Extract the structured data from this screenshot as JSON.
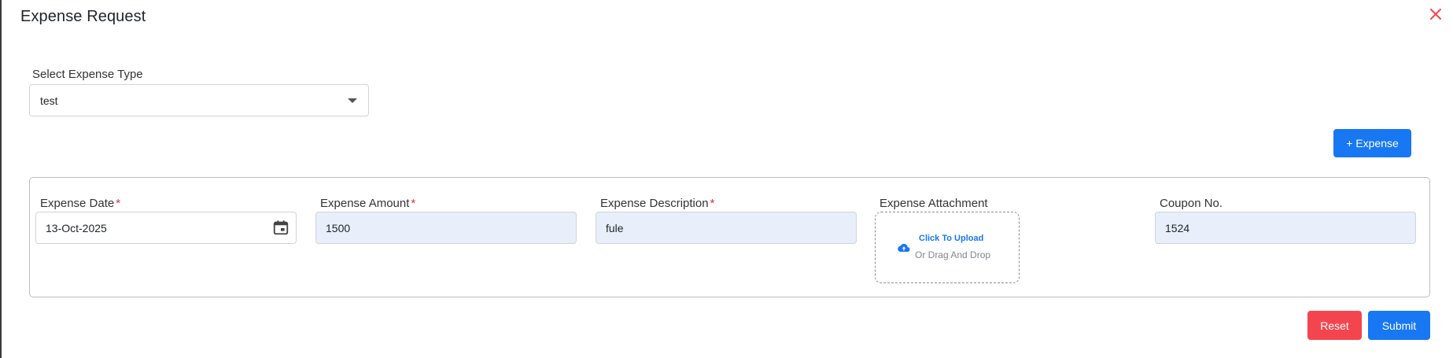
{
  "modal": {
    "title": "Expense Request",
    "close_icon": "close-icon",
    "close_color": "#f4454f"
  },
  "expense_type": {
    "label": "Select Expense Type",
    "value": "test"
  },
  "add_expense_label": "+ Expense",
  "expense_row": {
    "date": {
      "label": "Expense Date",
      "required": "*",
      "value": "13-Oct-2025",
      "icon": "calendar-icon"
    },
    "amount": {
      "label": "Expense Amount",
      "required": "*",
      "value": "1500"
    },
    "description": {
      "label": "Expense Description",
      "required": "*",
      "value": "fule"
    },
    "attachment": {
      "label": "Expense Attachment",
      "upload_text": "Click To Upload",
      "drag_text": "Or Drag And Drop",
      "icon": "cloud-upload-icon"
    },
    "coupon": {
      "label": "Coupon No.",
      "value": "1524"
    }
  },
  "actions": {
    "reset_label": "Reset",
    "submit_label": "Submit"
  },
  "colors": {
    "primary": "#1877f2",
    "danger": "#f4454f",
    "filled_input": "#e8effb",
    "required_mark": "#e03131"
  }
}
